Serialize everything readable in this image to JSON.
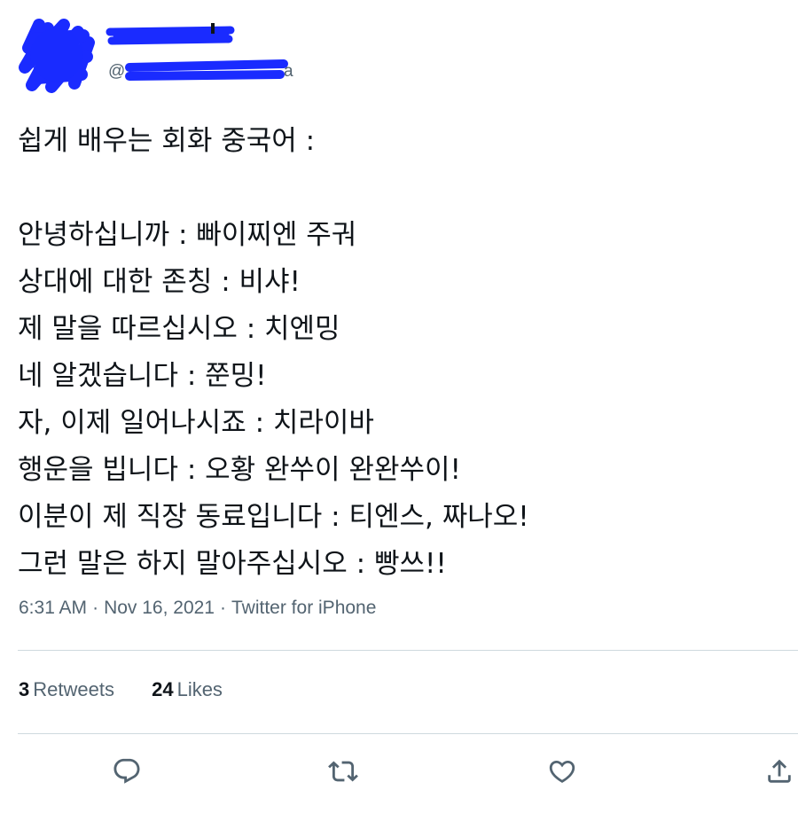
{
  "author": {
    "handle_prefix": "@",
    "handle_suffix": "a"
  },
  "tweet": {
    "lines": [
      "쉽게 배우는 회화 중국어 :",
      "",
      "안녕하십니까 : 빠이찌엔 주궈",
      "상대에 대한 존칭 : 비샤!",
      "제 말을 따르십시오 : 치엔밍",
      "네 알겠습니다 : 쭌밍!",
      "자, 이제 일어나시죠 : 치라이바",
      "행운을 빕니다 : 오황 완쑤이 완완쑤이!",
      "이분이 제 직장 동료입니다 : 티엔스, 짜나오!",
      "그런 말은 하지 말아주십시오 : 빵쓰!!"
    ]
  },
  "meta": {
    "time": "6:31 AM",
    "separator": "·",
    "date": "Nov 16, 2021",
    "source": "Twitter for iPhone"
  },
  "stats": {
    "retweets_count": "3",
    "retweets_label": "Retweets",
    "likes_count": "24",
    "likes_label": "Likes"
  },
  "actions": {
    "icons": [
      "reply-icon",
      "retweet-icon",
      "like-icon",
      "share-icon"
    ]
  },
  "colors": {
    "redaction": "#1a2bff",
    "text": "#0f1419",
    "secondary": "#536471",
    "divider": "#cfd9de"
  }
}
